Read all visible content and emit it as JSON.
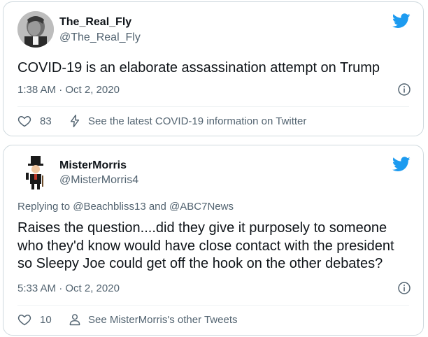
{
  "tweets": [
    {
      "display_name": "The_Real_Fly",
      "handle": "@The_Real_Fly",
      "text": "COVID-19 is an elaborate assassination attempt on Trump",
      "timestamp": "1:38 AM · Oct 2, 2020",
      "likes": "83",
      "action_link": "See the latest COVID-19 information on Twitter",
      "action_icon": "bolt-icon"
    },
    {
      "display_name": "MisterMorris",
      "handle": "@MisterMorris4",
      "reply_prefix": "Replying to",
      "reply_mention_1": "@Beachbliss13",
      "reply_and": "and",
      "reply_mention_2": "@ABC7News",
      "text_lines": [
        "Raises the question....did they give it purposely to someone",
        "who they'd know would have close contact with the president",
        "so Sleepy Joe could get off the hook on the other debates?"
      ],
      "timestamp": "5:33 AM · Oct 2, 2020",
      "likes": "10",
      "action_link": "See MisterMorris's other Tweets",
      "action_icon": "person-icon"
    }
  ],
  "colors": {
    "brand": "#1d9bf0",
    "secondary_text": "#536471",
    "primary_text": "#0f1419",
    "border": "#cfd9de"
  }
}
